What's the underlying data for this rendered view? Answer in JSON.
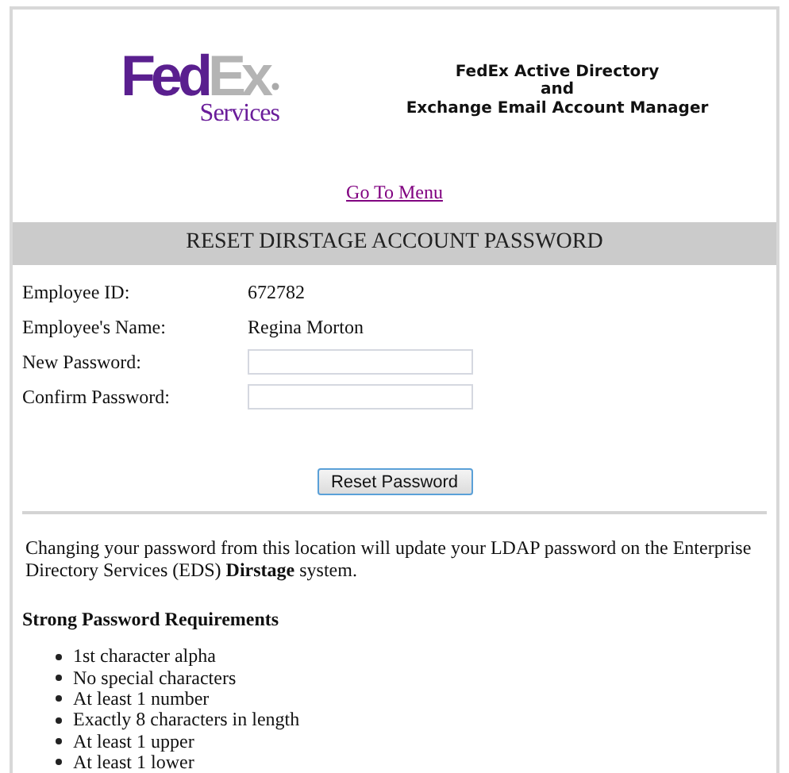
{
  "logo": {
    "primary": "Fed",
    "secondary": "Ex",
    "tagline": "Services"
  },
  "app_title": [
    "FedEx Active Directory",
    "and",
    "Exchange Email Account Manager"
  ],
  "menu_link": "Go To Menu",
  "section_title": "RESET DIRSTAGE ACCOUNT PASSWORD",
  "form": [
    {
      "kind": "info",
      "label": "Employee ID:",
      "value": "672782"
    },
    {
      "kind": "info",
      "label": "Employee's Name:",
      "value": "Regina Morton"
    },
    {
      "kind": "password",
      "label": "New Password:"
    },
    {
      "kind": "password",
      "label": "Confirm Password:"
    }
  ],
  "submit_button": "Reset Password",
  "notice": "Changing your password from this location will update your LDAP password on the Enterprise Directory Services (EDS) **Dirstage** system.",
  "requirements": {
    "heading": "Strong Password Requirements",
    "items": [
      "1st character alpha",
      "No special characters",
      "At least 1 number",
      "Exactly 8 characters in length",
      "At least 1 upper",
      "At least 1 lower"
    ]
  }
}
